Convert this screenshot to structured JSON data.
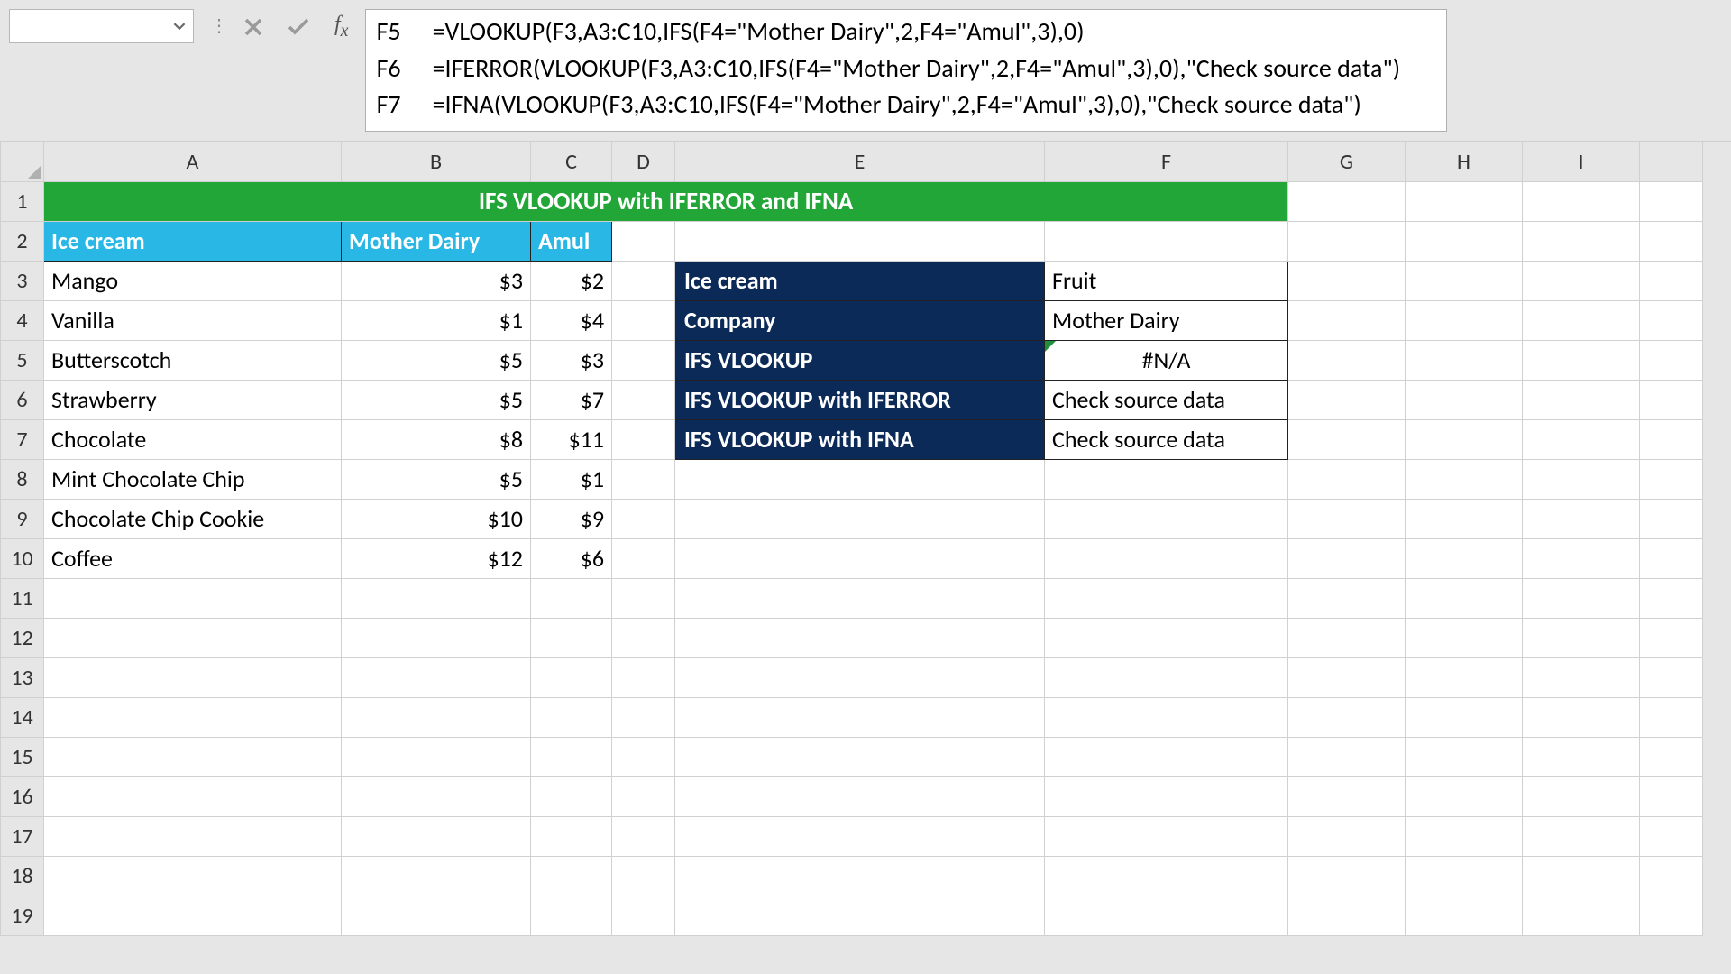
{
  "formula_bar": {
    "name_box_value": "",
    "rows": [
      {
        "ref": "F5",
        "formula": "=VLOOKUP(F3,A3:C10,IFS(F4=\"Mother Dairy\",2,F4=\"Amul\",3),0)"
      },
      {
        "ref": "F6",
        "formula": "=IFERROR(VLOOKUP(F3,A3:C10,IFS(F4=\"Mother Dairy\",2,F4=\"Amul\",3),0),\"Check source data\")"
      },
      {
        "ref": "F7",
        "formula": "=IFNA(VLOOKUP(F3,A3:C10,IFS(F4=\"Mother Dairy\",2,F4=\"Amul\",3),0),\"Check source data\")"
      }
    ]
  },
  "columns": [
    "A",
    "B",
    "C",
    "D",
    "E",
    "F",
    "G",
    "H",
    "I",
    ""
  ],
  "row_numbers": [
    "1",
    "2",
    "3",
    "4",
    "5",
    "6",
    "7",
    "8",
    "9",
    "10",
    "11",
    "12",
    "13",
    "14",
    "15",
    "16",
    "17",
    "18",
    "19"
  ],
  "title": "IFS VLOOKUP with IFERROR and IFNA",
  "table_headers": {
    "a": "Ice cream",
    "b": "Mother Dairy",
    "c": "Amul"
  },
  "ice_cream_rows": [
    {
      "name": "Mango",
      "md": "$3",
      "amul": "$2"
    },
    {
      "name": "Vanilla",
      "md": "$1",
      "amul": "$4"
    },
    {
      "name": "Butterscotch",
      "md": "$5",
      "amul": "$3"
    },
    {
      "name": "Strawberry",
      "md": "$5",
      "amul": "$7"
    },
    {
      "name": "Chocolate",
      "md": "$8",
      "amul": "$11"
    },
    {
      "name": "Mint Chocolate Chip",
      "md": "$5",
      "amul": "$1"
    },
    {
      "name": "Chocolate Chip Cookie",
      "md": "$10",
      "amul": "$9"
    },
    {
      "name": "Coffee",
      "md": "$12",
      "amul": "$6"
    }
  ],
  "lookup_panel": {
    "labels": {
      "ice_cream": "Ice cream",
      "company": "Company",
      "ifs_vlookup": "IFS VLOOKUP",
      "iferror": "IFS VLOOKUP with IFERROR",
      "ifna": "IFS VLOOKUP with IFNA"
    },
    "values": {
      "ice_cream": "Fruit",
      "company": "Mother Dairy",
      "ifs_vlookup": "#N/A",
      "iferror": "Check source data",
      "ifna": "Check source data"
    }
  },
  "chart_data": {
    "type": "table",
    "title": "IFS VLOOKUP with IFERROR and IFNA",
    "columns": [
      "Ice cream",
      "Mother Dairy",
      "Amul"
    ],
    "rows": [
      [
        "Mango",
        3,
        2
      ],
      [
        "Vanilla",
        1,
        4
      ],
      [
        "Butterscotch",
        5,
        3
      ],
      [
        "Strawberry",
        5,
        7
      ],
      [
        "Chocolate",
        8,
        11
      ],
      [
        "Mint Chocolate Chip",
        5,
        1
      ],
      [
        "Chocolate Chip Cookie",
        10,
        9
      ],
      [
        "Coffee",
        12,
        6
      ]
    ],
    "lookup_example": {
      "inputs": {
        "Ice cream": "Fruit",
        "Company": "Mother Dairy"
      },
      "outputs": {
        "IFS VLOOKUP": "#N/A",
        "IFS VLOOKUP with IFERROR": "Check source data",
        "IFS VLOOKUP with IFNA": "Check source data"
      }
    }
  }
}
